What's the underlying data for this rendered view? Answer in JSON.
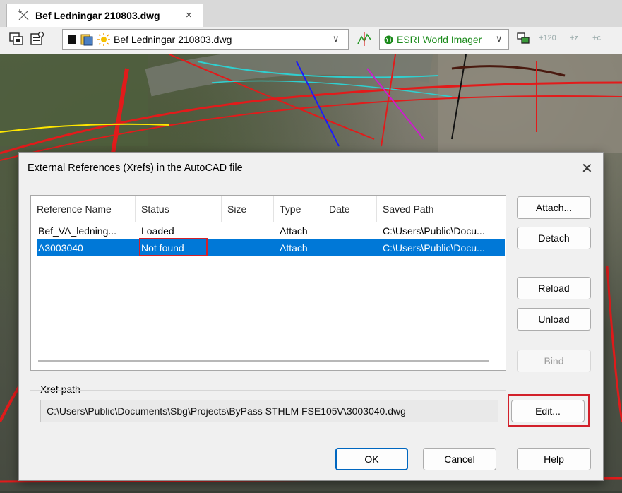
{
  "tab": {
    "title": "Bef Ledningar 210803.dwg",
    "close": "×"
  },
  "toolbar": {
    "file_select": "Bef Ledningar 210803.dwg",
    "map_select": "ESRI World Imager",
    "chevron": "∨",
    "icon_120": "120",
    "icon_z": "z",
    "icon_c": "c",
    "plus": "+"
  },
  "dialog": {
    "title": "External References (Xrefs) in the AutoCAD file",
    "close": "✕",
    "columns": [
      "Reference Name",
      "Status",
      "Size",
      "Type",
      "Date",
      "Saved Path"
    ],
    "rows": [
      {
        "name": "Bef_VA_ledning...",
        "status": "Loaded",
        "size": "",
        "type": "Attach",
        "date": "",
        "path": "C:\\Users\\Public\\Docu...",
        "selected": false
      },
      {
        "name": "A3003040",
        "status": "Not found",
        "size": "",
        "type": "Attach",
        "date": "",
        "path": "C:\\Users\\Public\\Docu...",
        "selected": true
      }
    ],
    "buttons": {
      "attach": "Attach...",
      "detach": "Detach",
      "reload": "Reload",
      "unload": "Unload",
      "bind": "Bind",
      "edit": "Edit...",
      "ok": "OK",
      "cancel": "Cancel",
      "help": "Help"
    },
    "xref_path_label": "Xref path",
    "xref_path": "C:\\Users\\Public\\Documents\\Sbg\\Projects\\ByPass STHLM FSE105\\A3003040.dwg"
  },
  "colors": {
    "selection": "#0078d7",
    "highlight": "#d2202a",
    "map_green": "#1a8a1a"
  }
}
